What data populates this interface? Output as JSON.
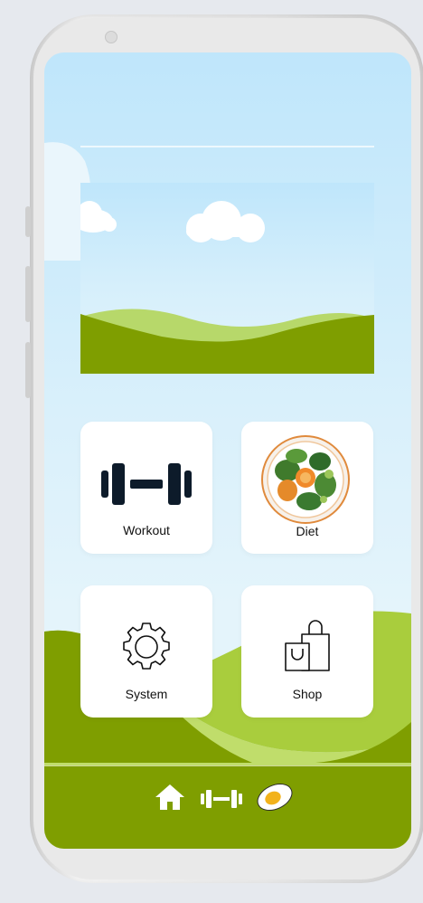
{
  "cards": {
    "workout_label": "Workout",
    "diet_label": "Diet",
    "system_label": "System",
    "shop_label": "Shop"
  },
  "icons": {
    "workout": "dumbbell-icon",
    "diet": "salad-plate-icon",
    "system": "gear-icon",
    "shop": "shopping-bags-icon",
    "nav_home": "home-icon",
    "nav_workout": "dumbbell-icon",
    "nav_diet": "egg-icon"
  },
  "colors": {
    "sky": "#c4e8fb",
    "grass_dark": "#7f9e00",
    "grass_light": "#c0dd6b",
    "card": "#ffffff",
    "icon_dark": "#0d1b2a"
  }
}
